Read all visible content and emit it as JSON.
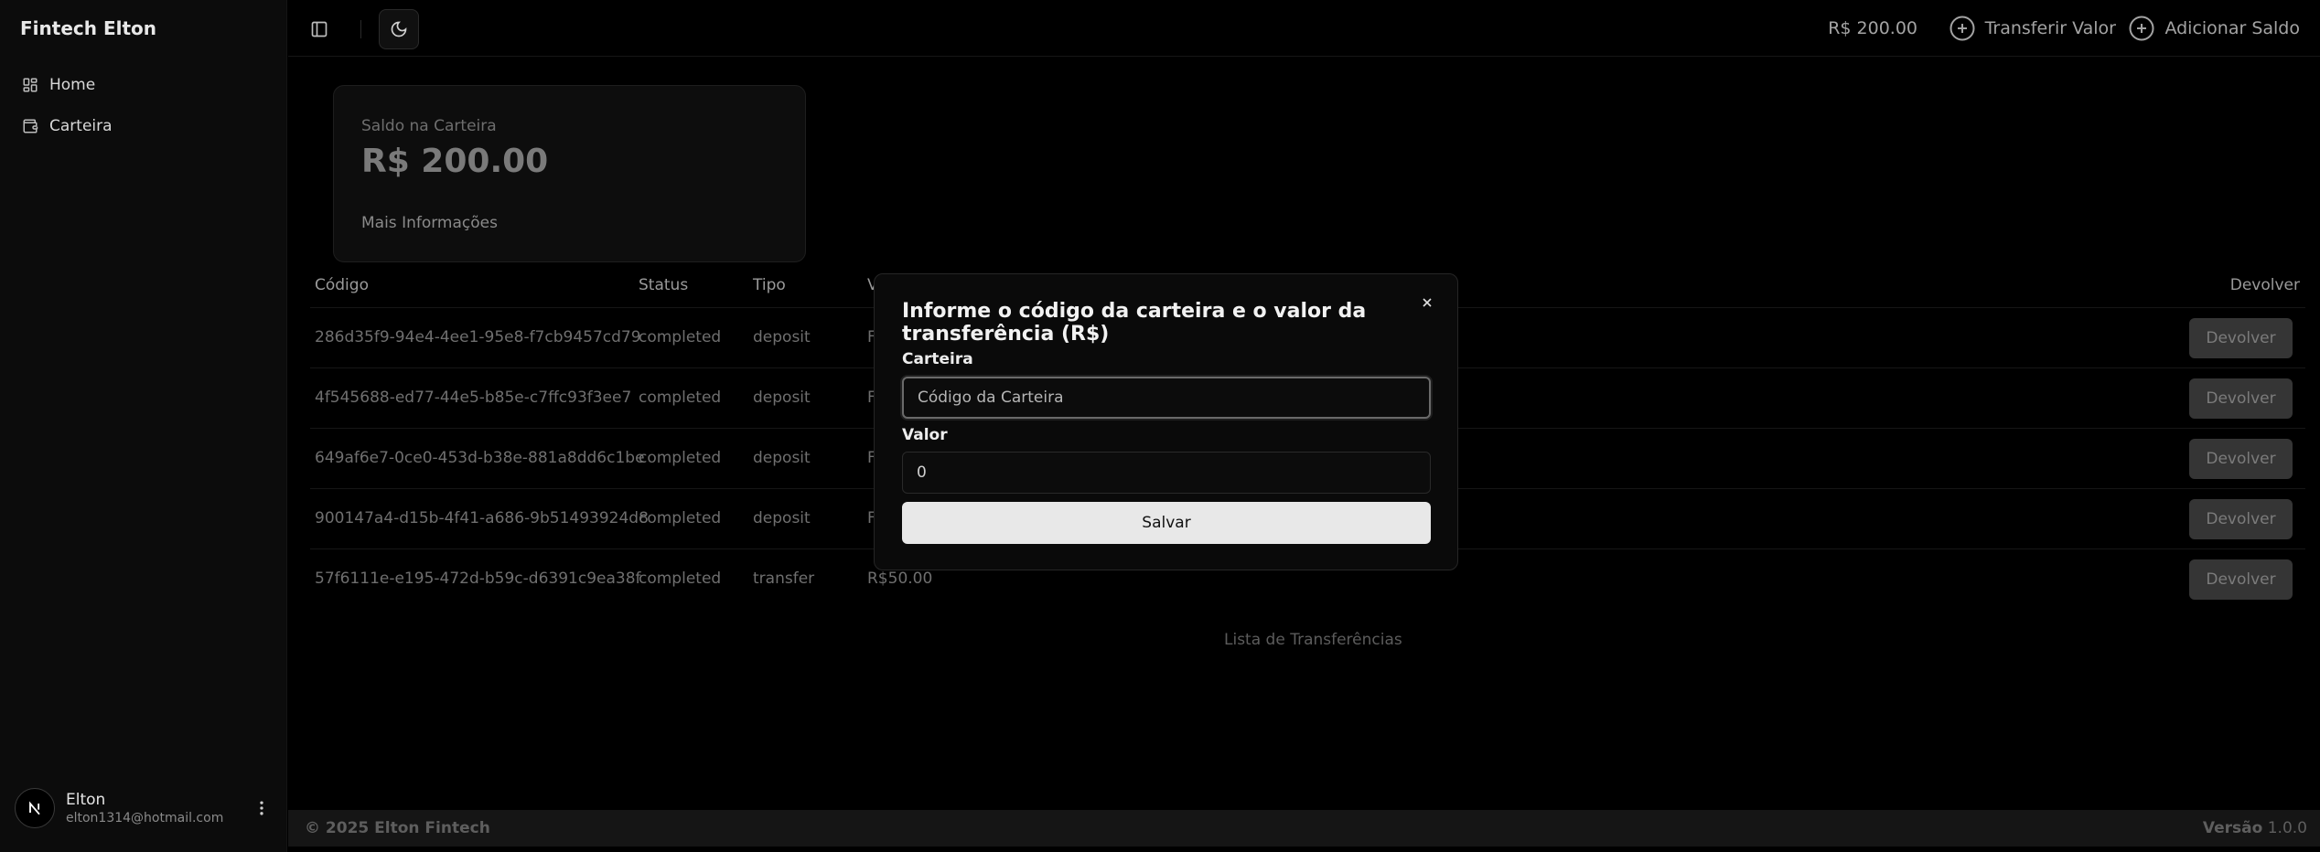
{
  "sidebar": {
    "brand": "Fintech Elton",
    "items": [
      {
        "label": "Home",
        "icon": "grid-icon"
      },
      {
        "label": "Carteira",
        "icon": "wallet-icon"
      }
    ],
    "user": {
      "name": "Elton",
      "email": "elton1314@hotmail.com"
    }
  },
  "header": {
    "balance": "R$ 200.00",
    "transfer_label": "Transferir Valor",
    "add_balance_label": "Adicionar Saldo"
  },
  "card": {
    "label": "Saldo na Carteira",
    "value": "R$ 200.00",
    "link": "Mais Informações"
  },
  "table": {
    "headers": {
      "code": "Código",
      "status": "Status",
      "type": "Tipo",
      "value": "V",
      "action": "Devolver"
    },
    "rows": [
      {
        "code": "286d35f9-94e4-4ee1-95e8-f7cb9457cd79",
        "status": "completed",
        "type": "deposit",
        "value": "F",
        "action": "Devolver"
      },
      {
        "code": "4f545688-ed77-44e5-b85e-c7ffc93f3ee7",
        "status": "completed",
        "type": "deposit",
        "value": "F",
        "action": "Devolver"
      },
      {
        "code": "649af6e7-0ce0-453d-b38e-881a8dd6c1be",
        "status": "completed",
        "type": "deposit",
        "value": "F",
        "action": "Devolver"
      },
      {
        "code": "900147a4-d15b-4f41-a686-9b51493924d8",
        "status": "completed",
        "type": "deposit",
        "value": "F",
        "action": "Devolver"
      },
      {
        "code": "57f6111e-e195-472d-b59c-d6391c9ea38f",
        "status": "completed",
        "type": "transfer",
        "value": "R$50.00",
        "action": "Devolver"
      }
    ],
    "caption": "Lista de Transferências"
  },
  "footer": {
    "copyright": "© 2025 Elton Fintech",
    "version_label": "Versão",
    "version": "1.0.0"
  },
  "modal": {
    "title": "Informe o código da carteira e o valor da transferência (R$)",
    "wallet_label": "Carteira",
    "wallet_placeholder": "Código da Carteira",
    "value_label": "Valor",
    "value": "0",
    "save_label": "Salvar"
  }
}
